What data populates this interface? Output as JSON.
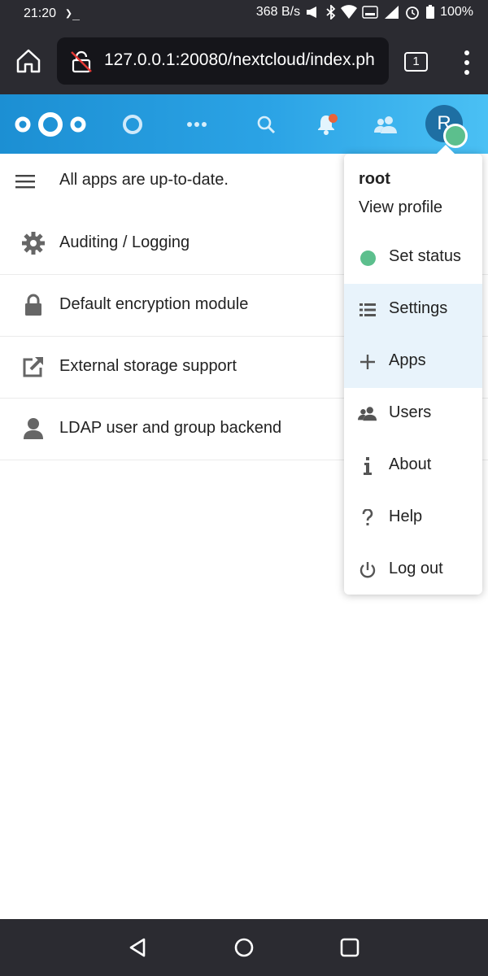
{
  "status_bar": {
    "time": "21:20",
    "terminal_glyph": "❯_",
    "net_speed": "368 B/s",
    "battery": "100%"
  },
  "browser": {
    "url": "127.0.0.1:20080/nextcloud/index.ph",
    "tab_count": "1"
  },
  "header": {
    "avatar_letter": "R",
    "nav_icons": [
      "files-icon",
      "more-apps-icon",
      "search-icon",
      "notifications-icon",
      "contacts-icon"
    ]
  },
  "main": {
    "update_status": "All apps are up-to-date.",
    "apps": [
      {
        "name": "Auditing / Logging",
        "icon": "gear-icon"
      },
      {
        "name": "Default encryption module",
        "icon": "lock-icon"
      },
      {
        "name": "External storage support",
        "icon": "external-link-icon"
      },
      {
        "name": "LDAP user and group backend",
        "icon": "user-icon"
      }
    ]
  },
  "user_menu": {
    "username": "root",
    "view_profile": "View profile",
    "items": [
      {
        "label": "Set status",
        "icon": "status-dot-icon"
      },
      {
        "label": "Settings",
        "icon": "settings-list-icon"
      },
      {
        "label": "Apps",
        "icon": "plus-icon"
      },
      {
        "label": "Users",
        "icon": "users-icon"
      },
      {
        "label": "About",
        "icon": "info-icon"
      },
      {
        "label": "Help",
        "icon": "help-icon"
      },
      {
        "label": "Log out",
        "icon": "power-icon"
      }
    ]
  },
  "colors": {
    "header_start": "#1c8fd3",
    "header_end": "#4ac0f4",
    "status_online": "#5cbf8d",
    "notification": "#e9633a",
    "active_item_bg": "#e8f3fb"
  }
}
